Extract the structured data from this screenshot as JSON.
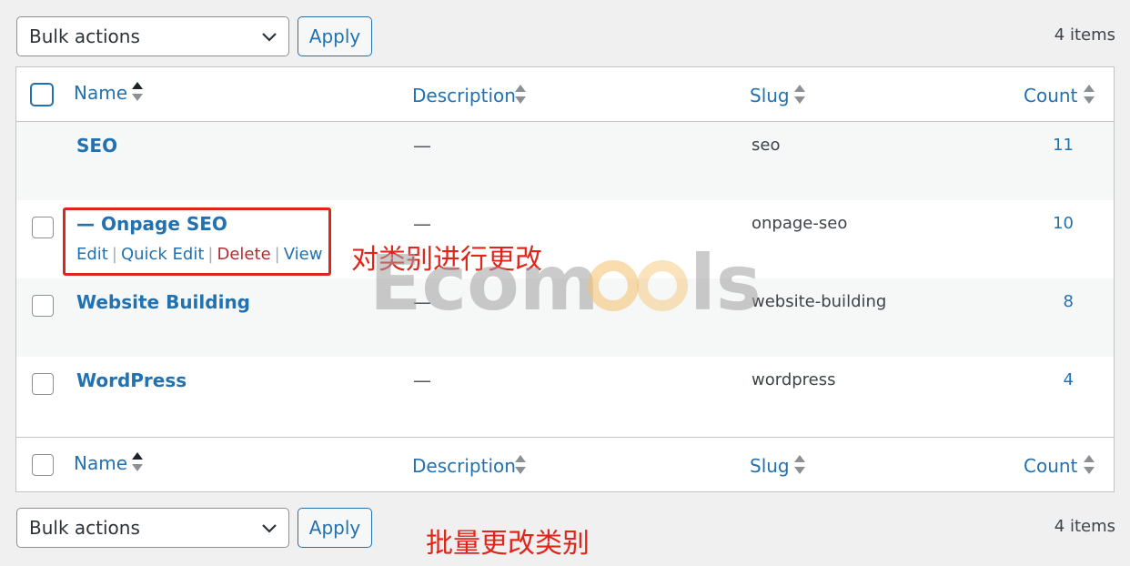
{
  "top_nav": {
    "bulk_actions": "Bulk actions",
    "apply": "Apply",
    "items_count": "4 items"
  },
  "bottom_nav": {
    "bulk_actions": "Bulk actions",
    "apply": "Apply",
    "items_count": "4 items"
  },
  "columns": {
    "name": "Name",
    "description": "Description",
    "slug": "Slug",
    "count": "Count"
  },
  "rows": [
    {
      "name": "SEO",
      "description": "—",
      "slug": "seo",
      "count": "11"
    },
    {
      "name": "— Onpage SEO",
      "description": "—",
      "slug": "onpage-seo",
      "count": "10"
    },
    {
      "name": "Website Building",
      "description": "—",
      "slug": "website-building",
      "count": "8"
    },
    {
      "name": "WordPress",
      "description": "—",
      "slug": "wordpress",
      "count": "4"
    }
  ],
  "row_actions": {
    "edit": "Edit",
    "quick_edit": "Quick Edit",
    "delete": "Delete",
    "view": "View"
  },
  "annotations": {
    "edit_category": "对类别进行更改",
    "bulk_edit": "批量更改类别"
  },
  "watermark": "Ecomools",
  "colors": {
    "link": "#2271b1",
    "delete": "#b32d2e",
    "annotation": "#e0251b"
  }
}
